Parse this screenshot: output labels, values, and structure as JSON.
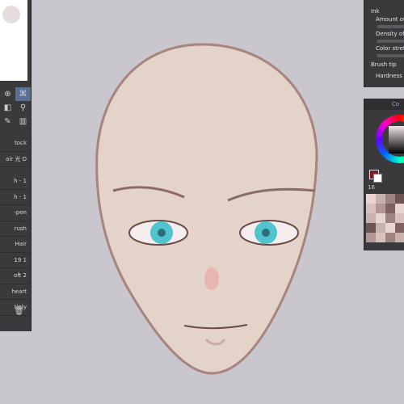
{
  "left_panel": {
    "brushes": [
      "tock",
      "air 光 D",
      "",
      "h - 1",
      "h - 1",
      "-pen",
      "rush",
      "Hair",
      "19 1",
      "oft 2",
      "heart",
      "tiply"
    ]
  },
  "right_panel": {
    "properties": [
      "Ink",
      "Amount of p",
      "Density of p",
      "Color stretc",
      "Brush tip",
      "Hardness"
    ]
  },
  "color_panel": {
    "header": "Co",
    "info": "16"
  },
  "colors": {
    "panel_bg": "#3a3a3d",
    "canvas_bg": "#c9c6cd",
    "skin": "#e3d3c8",
    "eye": "#4fc4cf",
    "selected_tool": "#5b6f95",
    "main_color": "#7a1f2a"
  },
  "palette": [
    "#e8d4d0",
    "#c9b1ae",
    "#9e8380",
    "#6e5553",
    "#d8c0bd",
    "#b39693",
    "#80615f",
    "#e8d4d0",
    "#c9b1ae",
    "#e8d4d0",
    "#9e8380",
    "#d8c0bd",
    "#6e5553",
    "#c9b1ae",
    "#e8d4d0",
    "#80615f",
    "#b39693",
    "#d8c0bd",
    "#9e8380",
    "#c9b1ae"
  ]
}
